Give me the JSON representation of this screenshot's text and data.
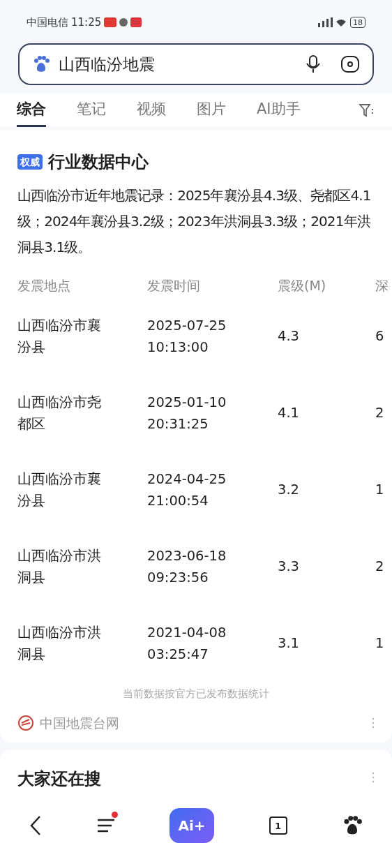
{
  "status_bar": {
    "carrier": "中国电信",
    "time": "11:25",
    "battery": "18"
  },
  "search": {
    "value": "山西临汾地震"
  },
  "tabs": [
    {
      "label": "综合",
      "selected": true
    },
    {
      "label": "笔记",
      "selected": false
    },
    {
      "label": "视频",
      "selected": false
    },
    {
      "label": "图片",
      "selected": false
    },
    {
      "label": "AI助手",
      "selected": false
    }
  ],
  "card": {
    "badge": "权威",
    "title": "行业数据中心",
    "summary": "山西临汾市近年地震记录：2025年襄汾县4.3级、尧都区4.1级；2024年襄汾县3.2级；2023年洪洞县3.3级；2021年洪洞县3.1级。",
    "table": {
      "columns": [
        "发震地点",
        "发震时间",
        "震级(M)",
        "深"
      ],
      "rows": [
        [
          "山西临汾市襄汾县",
          "2025-07-25 10:13:00",
          "4.3",
          "6"
        ],
        [
          "山西临汾市尧都区",
          "2025-01-10 20:31:25",
          "4.1",
          "2"
        ],
        [
          "山西临汾市襄汾县",
          "2024-04-25 21:00:54",
          "3.2",
          "1"
        ],
        [
          "山西临汾市洪洞县",
          "2023-06-18 09:23:56",
          "3.3",
          "2"
        ],
        [
          "山西临汾市洪洞县",
          "2021-04-08 03:25:47",
          "3.1",
          "1"
        ]
      ]
    },
    "note": "当前数据按官方已发布数据统计",
    "source": "中国地震台网"
  },
  "related": {
    "title": "大家还在搜"
  },
  "bottom_nav": {
    "ai_label": "Ai+",
    "tab_count": "1",
    "menu_has_dot": true
  }
}
